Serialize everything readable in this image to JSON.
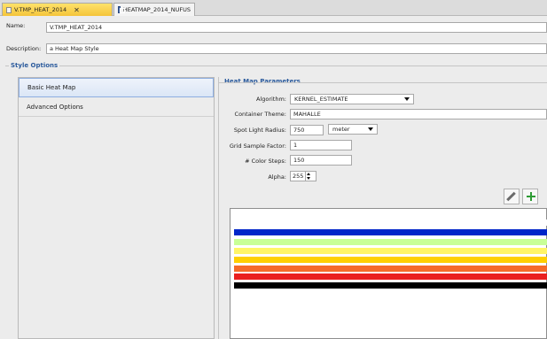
{
  "tabs": [
    {
      "label": "V.TMP_HEAT_2014",
      "close_glyph": "✕",
      "active": true
    },
    {
      "label": "HEATMAP_2014_NUFUS",
      "active": false
    }
  ],
  "form": {
    "name_label": "Name:",
    "name_value": "V.TMP_HEAT_2014",
    "description_label": "Description:",
    "description_value": "a Heat Map Style",
    "style_options_legend": "Style Options"
  },
  "left_panel": {
    "items": [
      {
        "label": "Basic Heat Map",
        "selected": true
      },
      {
        "label": "Advanced Options",
        "selected": false
      }
    ]
  },
  "params": {
    "legend": "Heat Map Parameters",
    "algorithm_label": "Algorithm:",
    "algorithm_value": "KERNEL_ESTIMATE",
    "container_theme_label": "Container Theme:",
    "container_theme_value": "MAHALLE",
    "spot_light_radius_label": "Spot Light Radius:",
    "spot_light_radius_value": "750",
    "spot_light_unit": "meter",
    "grid_sample_factor_label": "Grid Sample Factor:",
    "grid_sample_factor_value": "1",
    "color_steps_label": "# Color Steps:",
    "color_steps_value": "150",
    "alpha_label": "Alpha:",
    "alpha_value": "255"
  },
  "toolbar": {
    "edit_icon": "pencil-icon",
    "add_icon": "add-color-icon"
  },
  "color_ramp": [
    "#ffffff",
    "#0026c9",
    "#c8ff96",
    "#fff566",
    "#ffd000",
    "#f56b2a",
    "#ea2020",
    "#000000"
  ],
  "colors": {
    "accent": "#2d5c9d",
    "active_tab": "#f4c43a",
    "selection": "#dbe6f6"
  }
}
